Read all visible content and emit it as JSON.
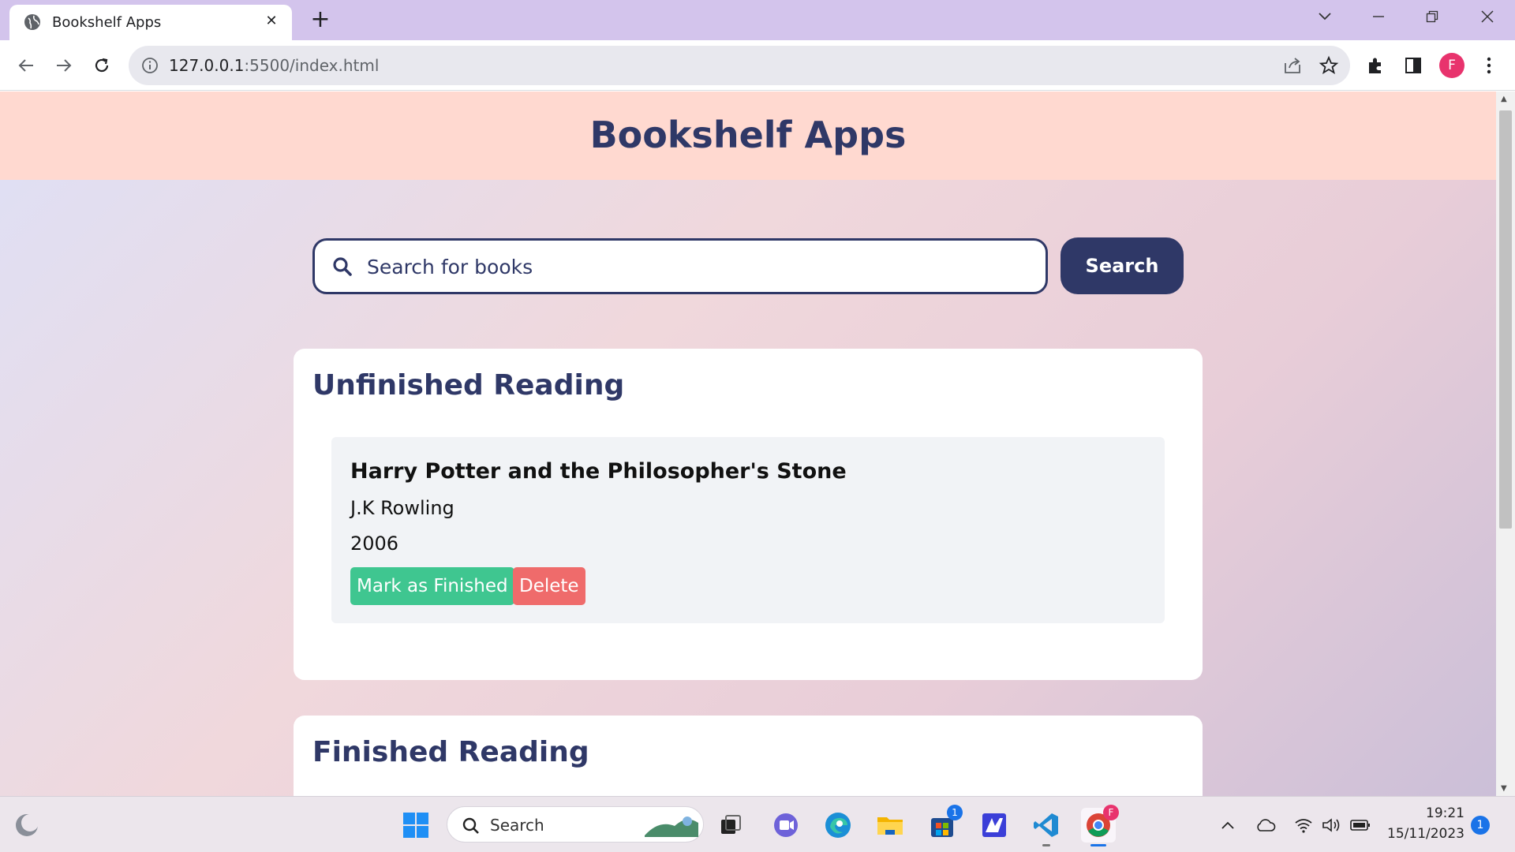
{
  "browser": {
    "tab_title": "Bookshelf Apps",
    "url_host": "127.0.0.1",
    "url_rest": ":5500/index.html",
    "profile_initial": "F"
  },
  "app": {
    "title": "Bookshelf Apps",
    "search": {
      "placeholder": "Search for books",
      "button_label": "Search"
    },
    "unfinished": {
      "heading": "Unfinished Reading",
      "books": [
        {
          "title": "Harry Potter and the Philosopher's Stone",
          "author": "J.K Rowling",
          "year": "2006",
          "finish_label": "Mark as Finished",
          "delete_label": "Delete"
        }
      ]
    },
    "finished": {
      "heading": "Finished Reading"
    }
  },
  "taskbar": {
    "search_label": "Search",
    "store_badge": "1",
    "time": "19:21",
    "date": "15/11/2023",
    "notification_count": "1"
  },
  "colors": {
    "primary": "#2f3867",
    "header_bg": "#ffd9d0",
    "finish_green": "#3fc690",
    "delete_red": "#ef6b6b"
  }
}
